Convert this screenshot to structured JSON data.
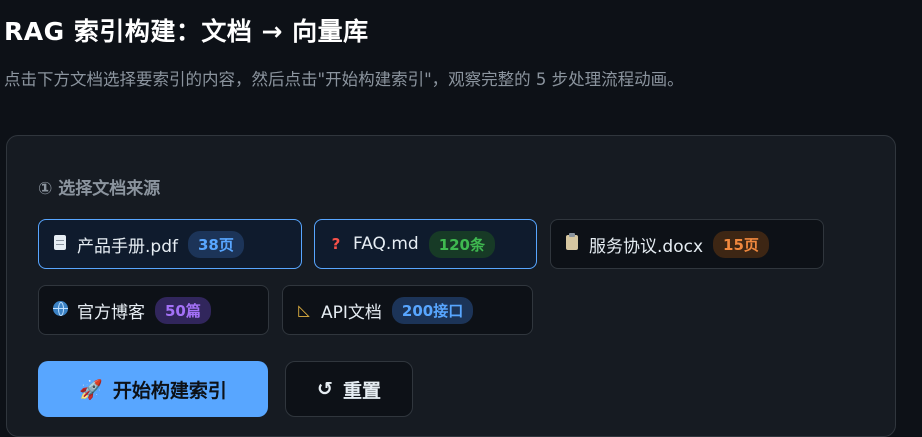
{
  "header": {
    "title": "RAG 索引构建：文档 → 向量库",
    "subtitle": "点击下方文档选择要索引的内容，然后点击\"开始构建索引\"，观察完整的 5 步处理流程动画。"
  },
  "source_section": {
    "label": "① 选择文档来源",
    "documents": [
      {
        "name": "产品手册.pdf",
        "count": "38页",
        "icon": "document-icon",
        "selected": true,
        "badge_color": "#58a6ff"
      },
      {
        "name": "FAQ.md",
        "count": "120条",
        "icon": "question-icon",
        "selected": true,
        "badge_color": "#3fb950"
      },
      {
        "name": "服务协议.docx",
        "count": "15页",
        "icon": "clipboard-icon",
        "selected": false,
        "badge_color": "#f0883e"
      },
      {
        "name": "官方博客",
        "count": "50篇",
        "icon": "globe-icon",
        "selected": false,
        "badge_color": "#a371f7"
      },
      {
        "name": "API文档",
        "count": "200接口",
        "icon": "ruler-icon",
        "selected": false,
        "badge_color": "#58a6ff"
      }
    ]
  },
  "actions": {
    "start_icon": "🚀",
    "start_label": "开始构建索引",
    "reset_icon": "↺",
    "reset_label": "重置"
  },
  "colors": {
    "background": "#0d1117",
    "panel": "#161b22",
    "accent": "#58a6ff"
  }
}
